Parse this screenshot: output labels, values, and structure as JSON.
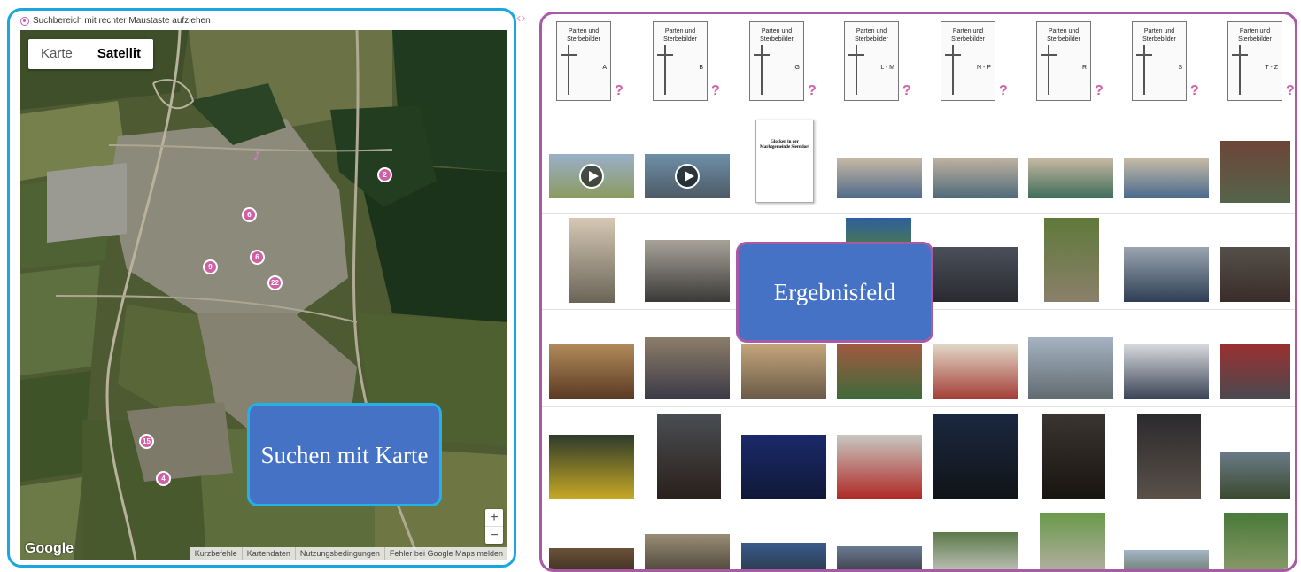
{
  "map_panel": {
    "hint_text": "Suchbereich mit rechter Maustaste aufziehen",
    "map_types": [
      "Karte",
      "Satellit"
    ],
    "active_map_type": "Satellit",
    "zoom_in": "+",
    "zoom_out": "−",
    "logo": "Google",
    "attribution": [
      "Kurzbefehle",
      "Kartendaten",
      "Nutzungsbedingungen",
      "Fehler bei Google Maps melden"
    ],
    "markers": [
      "2",
      "6",
      "6",
      "9",
      "22",
      "15",
      "4"
    ],
    "music_marker_icon": "music-note-icon"
  },
  "callouts": {
    "map": "Suchen mit Karte",
    "results": "Ergebnisfeld"
  },
  "results_panel": {
    "documents": [
      {
        "title": "Parten und Sterbebilder",
        "letter": "A"
      },
      {
        "title": "Parten und Sterbebilder",
        "letter": "B"
      },
      {
        "title": "Parten und Sterbebilder",
        "letter": "G"
      },
      {
        "title": "Parten und Sterbebilder",
        "letter": "L - M"
      },
      {
        "title": "Parten und Sterbebilder",
        "letter": "N - P"
      },
      {
        "title": "Parten und Sterbebilder",
        "letter": "R"
      },
      {
        "title": "Parten und Sterbebilder",
        "letter": "S"
      },
      {
        "title": "Parten und Sterbebilder",
        "letter": "T - Z"
      }
    ],
    "question_mark": "?",
    "booklet_title": "Glocken in der Marktgemeinde Sierndorf"
  },
  "colors": {
    "map_border": "#1aa7de",
    "results_border": "#a75ba5",
    "callout_fill": "#4572c4",
    "marker": "#d05fa6"
  }
}
